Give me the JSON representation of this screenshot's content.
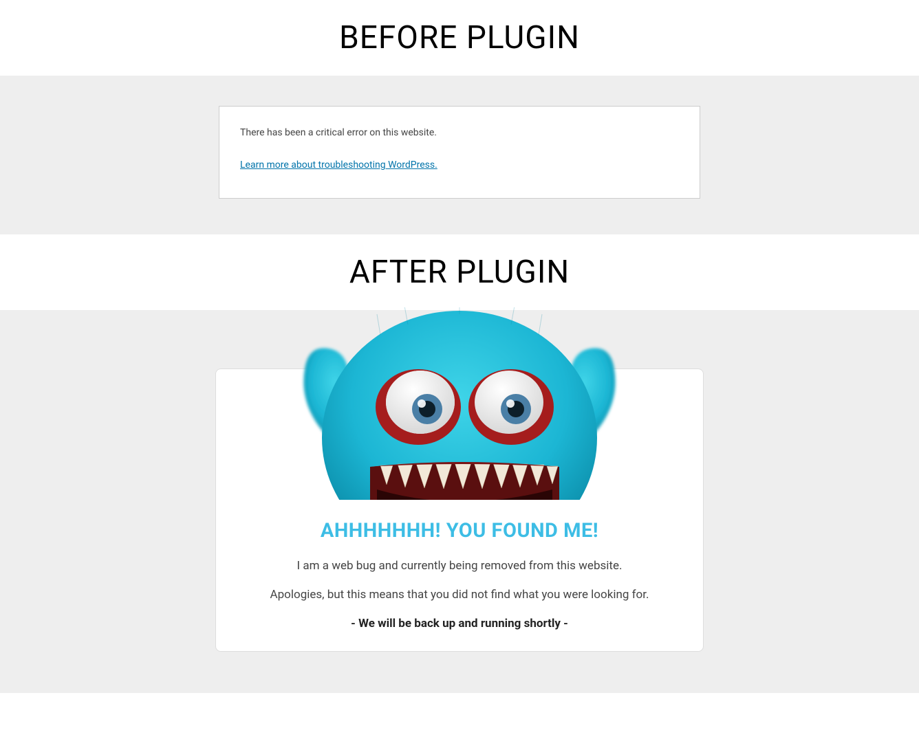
{
  "before": {
    "title": "BEFORE PLUGIN",
    "error_text": "There has been a critical error on this website.",
    "learn_link": "Learn more about troubleshooting WordPress."
  },
  "after": {
    "title": "AFTER PLUGIN",
    "heading": "AHHHHHHH! YOU FOUND ME!",
    "line1": "I am a web bug and currently being removed from this website.",
    "line2": "Apologies, but this means that you did not find what you were looking for.",
    "line3": "- We will be back up and running shortly -"
  },
  "colors": {
    "accent": "#3dbde5",
    "link": "#0073aa",
    "monster_fur": "#1cb6d4",
    "monster_fur_dark": "#0a8aa6",
    "eye_red": "#a51d1d",
    "eye_blue": "#4a7fa6",
    "mouth": "#5a0f0f",
    "teeth": "#f2e8d8"
  }
}
